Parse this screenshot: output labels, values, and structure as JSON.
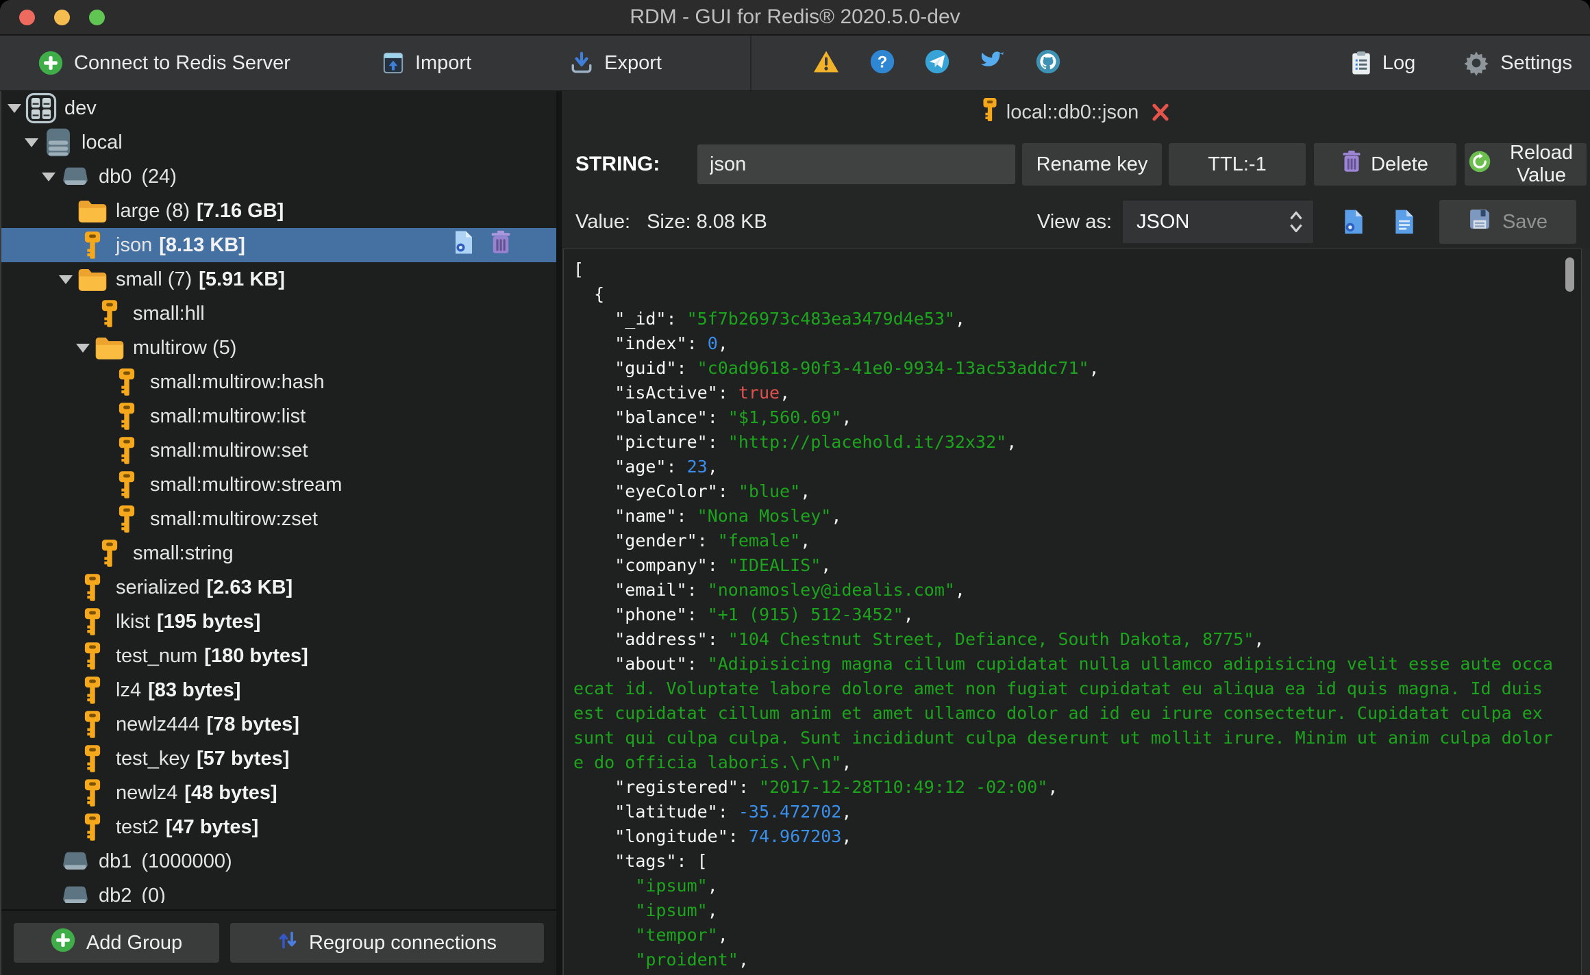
{
  "window": {
    "title": "RDM - GUI for Redis® 2020.5.0-dev"
  },
  "toolbar": {
    "connect_label": "Connect to Redis Server",
    "import_label": "Import",
    "export_label": "Export",
    "log_label": "Log",
    "settings_label": "Settings",
    "status_icons": [
      "warning-icon",
      "help-icon",
      "telegram-icon",
      "twitter-icon",
      "github-icon"
    ]
  },
  "sidebar": {
    "tree": [
      {
        "type": "connection",
        "label": "dev",
        "depth": 0,
        "expanded": true
      },
      {
        "type": "server",
        "label": "local",
        "depth": 1,
        "expanded": true
      },
      {
        "type": "db",
        "label": "db0",
        "count": "(24)",
        "depth": 2,
        "expanded": true
      },
      {
        "type": "folder",
        "label": "large (8)",
        "size": "[7.16 GB]",
        "depth": 3
      },
      {
        "type": "key",
        "label": "json",
        "size": "[8.13 KB]",
        "depth": 3,
        "selected": true
      },
      {
        "type": "folder",
        "label": "small (7)",
        "size": "[5.91 KB]",
        "depth": 3,
        "expanded": true
      },
      {
        "type": "key",
        "label": "small:hll",
        "depth": 4
      },
      {
        "type": "folder",
        "label": "multirow (5)",
        "depth": 4,
        "expanded": true
      },
      {
        "type": "key",
        "label": "small:multirow:hash",
        "depth": 5
      },
      {
        "type": "key",
        "label": "small:multirow:list",
        "depth": 5
      },
      {
        "type": "key",
        "label": "small:multirow:set",
        "depth": 5
      },
      {
        "type": "key",
        "label": "small:multirow:stream",
        "depth": 5
      },
      {
        "type": "key",
        "label": "small:multirow:zset",
        "depth": 5
      },
      {
        "type": "key",
        "label": "small:string",
        "depth": 4
      },
      {
        "type": "key",
        "label": "serialized",
        "size": "[2.63 KB]",
        "depth": 3
      },
      {
        "type": "key",
        "label": "lkist",
        "size": "[195 bytes]",
        "depth": 3
      },
      {
        "type": "key",
        "label": "test_num",
        "size": "[180 bytes]",
        "depth": 3
      },
      {
        "type": "key",
        "label": "lz4",
        "size": "[83 bytes]",
        "depth": 3
      },
      {
        "type": "key",
        "label": "newlz444",
        "size": "[78 bytes]",
        "depth": 3
      },
      {
        "type": "key",
        "label": "test_key",
        "size": "[57 bytes]",
        "depth": 3
      },
      {
        "type": "key",
        "label": "newlz4",
        "size": "[48 bytes]",
        "depth": 3
      },
      {
        "type": "key",
        "label": "test2",
        "size": "[47 bytes]",
        "depth": 3
      },
      {
        "type": "db",
        "label": "db1",
        "count": "(1000000)",
        "depth": 2
      },
      {
        "type": "db",
        "label": "db2",
        "count": "(0)",
        "depth": 2
      }
    ],
    "add_group_label": "Add Group",
    "regroup_label": "Regroup connections"
  },
  "main": {
    "tab": {
      "label": "local::db0::json"
    },
    "key_row": {
      "type_label": "STRING:",
      "key_value": "json",
      "rename_label": "Rename key",
      "ttl_label": "TTL:-1",
      "delete_label": "Delete",
      "reload_label": "Reload Value"
    },
    "value_row": {
      "value_label": "Value:",
      "size_label": "Size: 8.08 KB",
      "view_as_label": "View as:",
      "view_mode": "JSON",
      "save_label": "Save"
    },
    "editor": {
      "lines": [
        [
          [
            "p",
            "["
          ]
        ],
        [
          [
            "p",
            "  {"
          ]
        ],
        [
          [
            "p",
            "    "
          ],
          [
            "k",
            "\"_id\""
          ],
          [
            "p",
            ": "
          ],
          [
            "s",
            "\"5f7b26973c483ea3479d4e53\""
          ],
          [
            "p",
            ","
          ]
        ],
        [
          [
            "p",
            "    "
          ],
          [
            "k",
            "\"index\""
          ],
          [
            "p",
            ": "
          ],
          [
            "n",
            "0"
          ],
          [
            "p",
            ","
          ]
        ],
        [
          [
            "p",
            "    "
          ],
          [
            "k",
            "\"guid\""
          ],
          [
            "p",
            ": "
          ],
          [
            "s",
            "\"c0ad9618-90f3-41e0-9934-13ac53addc71\""
          ],
          [
            "p",
            ","
          ]
        ],
        [
          [
            "p",
            "    "
          ],
          [
            "k",
            "\"isActive\""
          ],
          [
            "p",
            ": "
          ],
          [
            "b",
            "true"
          ],
          [
            "p",
            ","
          ]
        ],
        [
          [
            "p",
            "    "
          ],
          [
            "k",
            "\"balance\""
          ],
          [
            "p",
            ": "
          ],
          [
            "s",
            "\"$1,560.69\""
          ],
          [
            "p",
            ","
          ]
        ],
        [
          [
            "p",
            "    "
          ],
          [
            "k",
            "\"picture\""
          ],
          [
            "p",
            ": "
          ],
          [
            "s",
            "\"http://placehold.it/32x32\""
          ],
          [
            "p",
            ","
          ]
        ],
        [
          [
            "p",
            "    "
          ],
          [
            "k",
            "\"age\""
          ],
          [
            "p",
            ": "
          ],
          [
            "n",
            "23"
          ],
          [
            "p",
            ","
          ]
        ],
        [
          [
            "p",
            "    "
          ],
          [
            "k",
            "\"eyeColor\""
          ],
          [
            "p",
            ": "
          ],
          [
            "s",
            "\"blue\""
          ],
          [
            "p",
            ","
          ]
        ],
        [
          [
            "p",
            "    "
          ],
          [
            "k",
            "\"name\""
          ],
          [
            "p",
            ": "
          ],
          [
            "s",
            "\"Nona Mosley\""
          ],
          [
            "p",
            ","
          ]
        ],
        [
          [
            "p",
            "    "
          ],
          [
            "k",
            "\"gender\""
          ],
          [
            "p",
            ": "
          ],
          [
            "s",
            "\"female\""
          ],
          [
            "p",
            ","
          ]
        ],
        [
          [
            "p",
            "    "
          ],
          [
            "k",
            "\"company\""
          ],
          [
            "p",
            ": "
          ],
          [
            "s",
            "\"IDEALIS\""
          ],
          [
            "p",
            ","
          ]
        ],
        [
          [
            "p",
            "    "
          ],
          [
            "k",
            "\"email\""
          ],
          [
            "p",
            ": "
          ],
          [
            "s",
            "\"nonamosley@idealis.com\""
          ],
          [
            "p",
            ","
          ]
        ],
        [
          [
            "p",
            "    "
          ],
          [
            "k",
            "\"phone\""
          ],
          [
            "p",
            ": "
          ],
          [
            "s",
            "\"+1 (915) 512-3452\""
          ],
          [
            "p",
            ","
          ]
        ],
        [
          [
            "p",
            "    "
          ],
          [
            "k",
            "\"address\""
          ],
          [
            "p",
            ": "
          ],
          [
            "s",
            "\"104 Chestnut Street, Defiance, South Dakota, 8775\""
          ],
          [
            "p",
            ","
          ]
        ],
        [
          [
            "p",
            "    "
          ],
          [
            "k",
            "\"about\""
          ],
          [
            "p",
            ": "
          ],
          [
            "s",
            "\"Adipisicing magna cillum cupidatat nulla ullamco adipisicing velit esse aute occa"
          ]
        ],
        [
          [
            "s",
            "ecat id. Voluptate labore dolore amet non fugiat cupidatat eu aliqua ea id quis magna. Id duis "
          ]
        ],
        [
          [
            "s",
            "est cupidatat cillum anim et amet ullamco dolor ad id eu irure consectetur. Cupidatat culpa ex "
          ]
        ],
        [
          [
            "s",
            "sunt qui culpa culpa. Sunt incididunt culpa deserunt ut mollit irure. Minim ut anim culpa dolor"
          ]
        ],
        [
          [
            "s",
            "e do officia laboris.\\r\\n\""
          ],
          [
            "p",
            ","
          ]
        ],
        [
          [
            "p",
            "    "
          ],
          [
            "k",
            "\"registered\""
          ],
          [
            "p",
            ": "
          ],
          [
            "s",
            "\"2017-12-28T10:49:12 -02:00\""
          ],
          [
            "p",
            ","
          ]
        ],
        [
          [
            "p",
            "    "
          ],
          [
            "k",
            "\"latitude\""
          ],
          [
            "p",
            ": "
          ],
          [
            "n",
            "-35.472702"
          ],
          [
            "p",
            ","
          ]
        ],
        [
          [
            "p",
            "    "
          ],
          [
            "k",
            "\"longitude\""
          ],
          [
            "p",
            ": "
          ],
          [
            "n",
            "74.967203"
          ],
          [
            "p",
            ","
          ]
        ],
        [
          [
            "p",
            "    "
          ],
          [
            "k",
            "\"tags\""
          ],
          [
            "p",
            ": ["
          ]
        ],
        [
          [
            "p",
            "      "
          ],
          [
            "s",
            "\"ipsum\""
          ],
          [
            "p",
            ","
          ]
        ],
        [
          [
            "p",
            "      "
          ],
          [
            "s",
            "\"ipsum\""
          ],
          [
            "p",
            ","
          ]
        ],
        [
          [
            "p",
            "      "
          ],
          [
            "s",
            "\"tempor\""
          ],
          [
            "p",
            ","
          ]
        ],
        [
          [
            "p",
            "      "
          ],
          [
            "s",
            "\"proident\""
          ],
          [
            "p",
            ","
          ]
        ]
      ]
    }
  },
  "colors": {
    "accent_selection": "#4470a2",
    "key_icon_orange": "#f5a81c",
    "string_green": "#1ca41c",
    "number_blue": "#3b8eea",
    "bool_red": "#e0514e"
  }
}
